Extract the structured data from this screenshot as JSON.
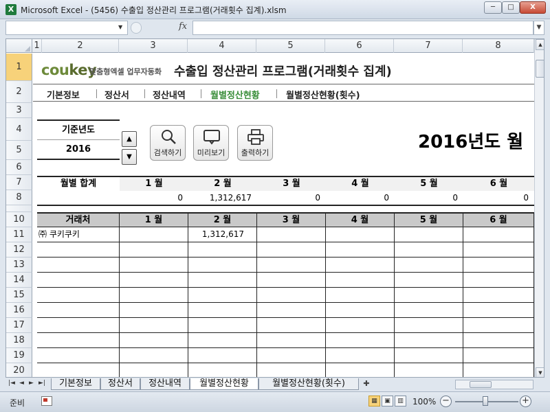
{
  "window": {
    "title": "Microsoft Excel - (5456) 수출입 정산관리 프로그램(거래횟수 집계).xlsm",
    "app_icon": "X",
    "minimize": "─",
    "maximize": "□",
    "close": "X"
  },
  "formula_bar": {
    "name_box": "",
    "fx": "fx",
    "formula": ""
  },
  "columns": [
    "1",
    "2",
    "3",
    "4",
    "5",
    "6",
    "7",
    "8"
  ],
  "rows": [
    "1",
    "2",
    "3",
    "4",
    "5",
    "6",
    "7",
    "8",
    "10",
    "11",
    "12",
    "13",
    "14",
    "15",
    "16",
    "17",
    "18",
    "19",
    "20"
  ],
  "header": {
    "logo_prefix": "cou",
    "logo_suffix": "key",
    "slogan": "맞춤형엑셀 업무자동화",
    "title": "수출입 정산관리 프로그램(거래횟수 집계)"
  },
  "nav": [
    "기본정보",
    "정산서",
    "정산내역",
    "월별정산현황",
    "월별정산현황(횟수)"
  ],
  "year_box": {
    "label": "기준년도",
    "value": "2016",
    "up": "▲",
    "down": "▼"
  },
  "buttons": {
    "search": "검색하기",
    "preview": "미리보기",
    "print": "출력하기"
  },
  "year_heading": "2016년도 월",
  "summary": {
    "label": "월별 합계",
    "months": [
      "1 월",
      "2 월",
      "3 월",
      "4 월",
      "5 월",
      "6 월"
    ],
    "values": [
      "0",
      "1,312,617",
      "0",
      "0",
      "0",
      "0"
    ]
  },
  "table": {
    "headers": [
      "거래처",
      "1 월",
      "2 월",
      "3 월",
      "4 월",
      "5 월",
      "6 월"
    ],
    "rows": [
      [
        "㈜ 쿠키쿠키",
        "",
        "1,312,617",
        "",
        "",
        "",
        ""
      ],
      [
        "",
        "",
        "",
        "",
        "",
        "",
        ""
      ],
      [
        "",
        "",
        "",
        "",
        "",
        "",
        ""
      ],
      [
        "",
        "",
        "",
        "",
        "",
        "",
        ""
      ],
      [
        "",
        "",
        "",
        "",
        "",
        "",
        ""
      ],
      [
        "",
        "",
        "",
        "",
        "",
        "",
        ""
      ],
      [
        "",
        "",
        "",
        "",
        "",
        "",
        ""
      ],
      [
        "",
        "",
        "",
        "",
        "",
        "",
        ""
      ],
      [
        "",
        "",
        "",
        "",
        "",
        "",
        ""
      ],
      [
        "",
        "",
        "",
        "",
        "",
        "",
        ""
      ]
    ]
  },
  "sheet_tabs": {
    "nav": [
      "|◄",
      "◄",
      "►",
      "►|"
    ],
    "tabs": [
      "기본정보",
      "정산서",
      "정산내역",
      "월별정산현황",
      "월별정산현황(횟수)"
    ],
    "active": "월별정산현황"
  },
  "status": {
    "ready": "준비",
    "zoom": "100%",
    "zoom_out": "−",
    "zoom_in": "+"
  }
}
